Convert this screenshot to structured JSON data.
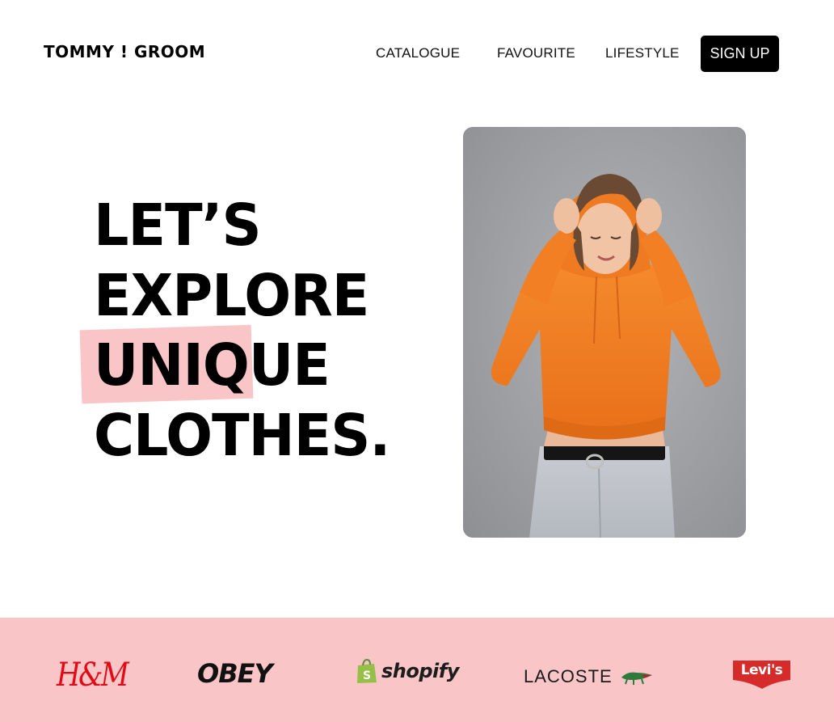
{
  "header": {
    "brand": "TOMMY ! GROOM",
    "nav": [
      {
        "label": "CATALOGUE"
      },
      {
        "label": "FAVOURITE"
      },
      {
        "label": "LIFESTYLE"
      }
    ],
    "signup_label": "SIGN UP"
  },
  "hero": {
    "lines": [
      "LET’S",
      "EXPLORE",
      "UNIQUE",
      "CLOTHES."
    ],
    "highlighted_word": "UNIQUE",
    "highlight_color": "#f9c5c6",
    "image": "woman-in-orange-hoodie-photo"
  },
  "brands": {
    "background": "#f9c5c6",
    "items": [
      {
        "name": "H&M",
        "text": "H&M",
        "color": "#e10b17"
      },
      {
        "name": "OBEY",
        "text": "OBEY",
        "color": "#111111"
      },
      {
        "name": "shopify",
        "text": "shopify",
        "color": "#1c1c1c",
        "icon": "shopping-bag-icon"
      },
      {
        "name": "LACOSTE",
        "text": "LACOSTE",
        "color": "#1a1a1a",
        "icon": "crocodile-icon"
      },
      {
        "name": "Levi's",
        "text": "Levi's",
        "color": "#d52b2b"
      }
    ]
  },
  "colors": {
    "accent": "#000000",
    "pink": "#f9c5c6",
    "hoodie": "#f07a1e"
  }
}
